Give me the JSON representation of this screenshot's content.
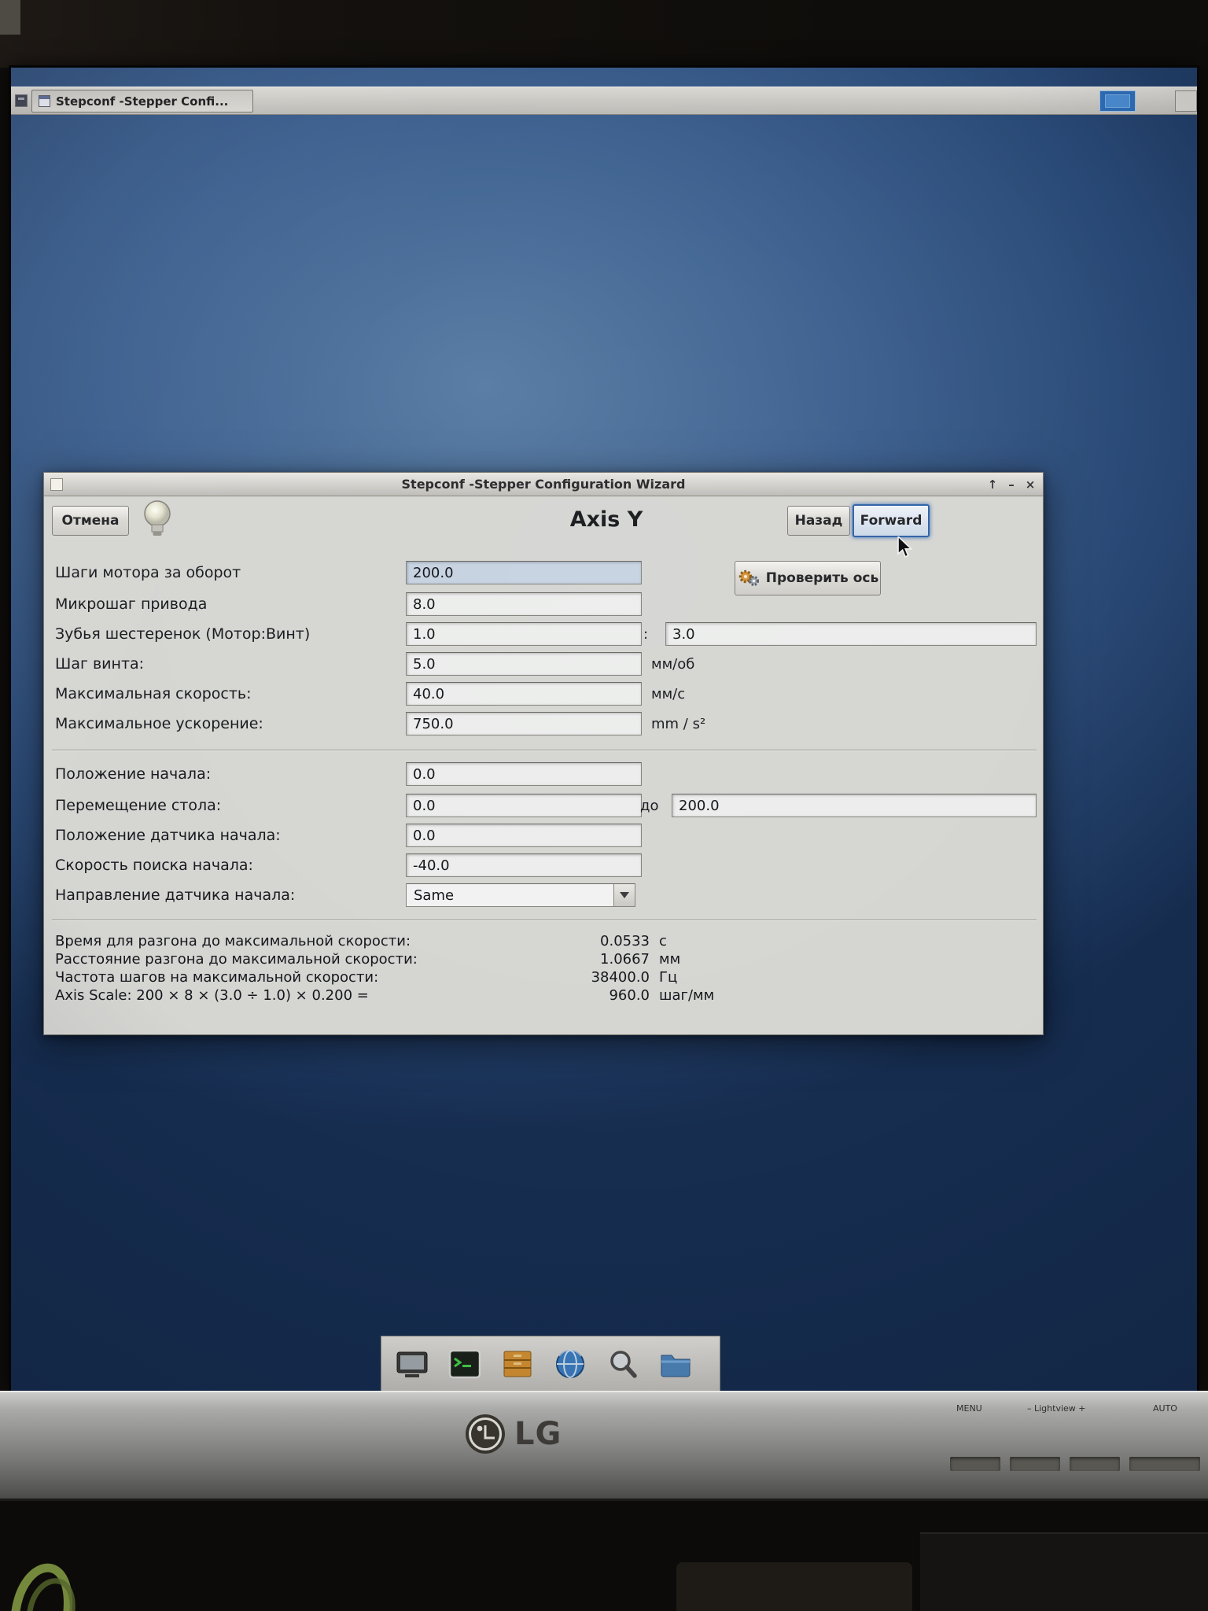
{
  "taskbar": {
    "task_button_label": "Stepconf -Stepper Confi..."
  },
  "window": {
    "title": "Stepconf -Stepper Configuration Wizard",
    "controls": {
      "shade": "↑",
      "minimize": "–",
      "close": "×"
    },
    "header": {
      "cancel_label": "Отмена",
      "axis_title": "Axis Y",
      "back_label": "Назад",
      "forward_label": "Forward"
    },
    "test_axis_label": "Проверить ось",
    "form": {
      "steps_label": "Шаги мотора за оборот",
      "steps_value": "200.0",
      "microstep_label": "Микрошаг привода",
      "microstep_value": "8.0",
      "pulley_label": "Зубья шестеренок (Мотор:Винт)",
      "pulley_motor_value": "1.0",
      "pulley_separator": ":",
      "pulley_screw_value": "3.0",
      "pitch_label": "Шаг винта:",
      "pitch_value": "5.0",
      "pitch_unit": "мм/об",
      "max_velocity_label": "Максимальная скорость:",
      "max_velocity_value": "40.0",
      "max_velocity_unit": "мм/с",
      "max_accel_label": "Максимальное ускорение:",
      "max_accel_value": "750.0",
      "max_accel_unit": "mm / s²",
      "home_position_label": "Положение начала:",
      "home_position_value": "0.0",
      "table_travel_label": "Перемещение стола:",
      "table_travel_min_value": "0.0",
      "table_travel_to": "до",
      "table_travel_max_value": "200.0",
      "home_switch_label": "Положение датчика начала:",
      "home_switch_value": "0.0",
      "search_velocity_label": "Скорость поиска начала:",
      "search_velocity_value": "-40.0",
      "latch_direction_label": "Направление датчика начала:",
      "latch_direction_value": "Same"
    },
    "summary": {
      "rows": [
        {
          "label": "Время для разгона до максимальной скорости:",
          "number": "0.0533",
          "unit": "с"
        },
        {
          "label": "Расстояние разгона до максимальной скорости:",
          "number": "1.0667",
          "unit": "мм"
        },
        {
          "label": "Частота шагов на максимальной скорости:",
          "number": "38400.0",
          "unit": "Гц"
        },
        {
          "label": "Axis Scale: 200 × 8 × (3.0 ÷ 1.0) × 0.200 =",
          "number": "960.0",
          "unit": "шаг/мм"
        }
      ]
    }
  },
  "dock": {
    "icons": [
      "display-icon",
      "terminal-icon",
      "package-icon",
      "browser-globe-icon",
      "search-icon",
      "folder-icon"
    ]
  },
  "monitor": {
    "brand": "LG",
    "controls": {
      "menu": "MENU",
      "lightview": "–  Lightview  +",
      "auto": "AUTO"
    }
  }
}
